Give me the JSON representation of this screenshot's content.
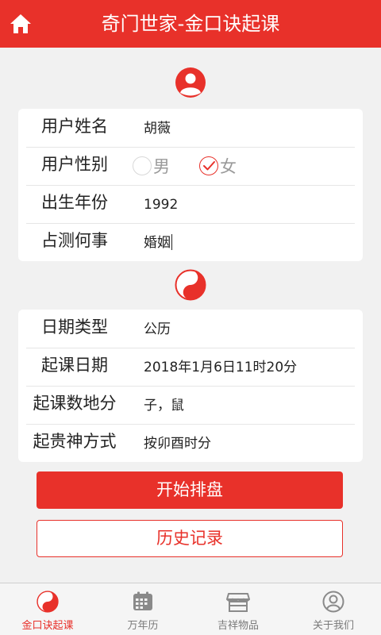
{
  "header": {
    "title": "奇门世家-金口诀起课"
  },
  "user_form": {
    "name_label": "用户姓名",
    "name_value": "胡薇",
    "gender_label": "用户性别",
    "gender_options": [
      {
        "label": "男",
        "checked": false
      },
      {
        "label": "女",
        "checked": true
      }
    ],
    "birth_year_label": "出生年份",
    "birth_year_value": "1992",
    "question_label": "占测何事",
    "question_value": "婚姻"
  },
  "date_form": {
    "date_type_label": "日期类型",
    "date_type_value": "公历",
    "start_date_label": "起课日期",
    "start_date_value": "2018年1月6日11时20分",
    "earth_branch_label": "起课数地分",
    "earth_branch_value": "子，鼠",
    "noble_method_label": "起贵神方式",
    "noble_method_value": "按卯酉时分"
  },
  "buttons": {
    "start_label": "开始排盘",
    "history_label": "历史记录"
  },
  "tabbar": {
    "items": [
      {
        "label": "金口诀起课",
        "icon": "yin-yang-icon",
        "active": true
      },
      {
        "label": "万年历",
        "icon": "calendar-icon",
        "active": false
      },
      {
        "label": "吉祥物品",
        "icon": "shop-icon",
        "active": false
      },
      {
        "label": "关于我们",
        "icon": "user-circle-icon",
        "active": false
      }
    ]
  },
  "colors": {
    "accent": "#e8312a",
    "background": "#f1f1f1",
    "inactive": "#7a7a7a"
  }
}
